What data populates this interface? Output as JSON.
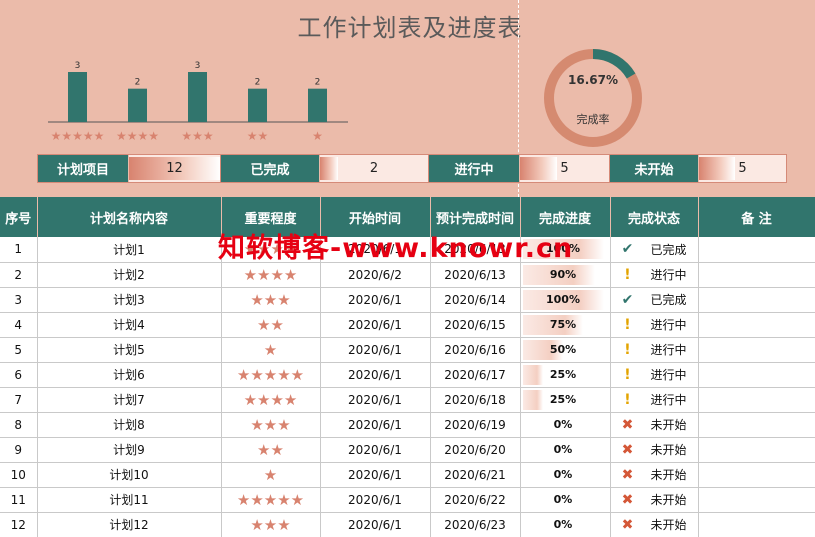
{
  "title": "工作计划表及进度表",
  "colors": {
    "accent": "#31756d",
    "background": "#ebbbaa",
    "star": "#d8836f",
    "done": "#31756d",
    "inprogress": "#e3a400",
    "todo": "#d45737"
  },
  "chart_data": [
    {
      "type": "bar",
      "categories": [
        "★★★★★",
        "★★★★",
        "★★★",
        "★★",
        "★"
      ],
      "values": [
        3,
        2,
        3,
        2,
        2
      ],
      "data_labels": [
        "3",
        "2",
        "3",
        "2",
        "2"
      ],
      "ylim": [
        0,
        3.6
      ]
    },
    {
      "type": "pie",
      "variant": "donut",
      "values": [
        16.67,
        83.33
      ],
      "center_value": "16.67%",
      "center_label": "完成率"
    }
  ],
  "summary": [
    {
      "label": "计划项目",
      "value": "12",
      "fill": 1.0
    },
    {
      "label": "已完成",
      "value": "2",
      "fill": 0.167
    },
    {
      "label": "进行中",
      "value": "5",
      "fill": 0.417
    },
    {
      "label": "未开始",
      "value": "5",
      "fill": 0.417
    }
  ],
  "table": {
    "headers": [
      "序号",
      "计划名称内容",
      "重要程度",
      "开始时间",
      "预计完成时间",
      "完成进度",
      "完成状态",
      "备 注"
    ],
    "rows": [
      {
        "no": "1",
        "name": "计划1",
        "stars": "★★★★",
        "start": "2020/6/1",
        "end": "2020/6/13",
        "progress": "100%",
        "pct": 1.0,
        "status": "已完成",
        "icon": "check-icon"
      },
      {
        "no": "2",
        "name": "计划2",
        "stars": "★★★★",
        "start": "2020/6/2",
        "end": "2020/6/13",
        "progress": "90%",
        "pct": 0.9,
        "status": "进行中",
        "icon": "exclamation-icon"
      },
      {
        "no": "3",
        "name": "计划3",
        "stars": "★★★",
        "start": "2020/6/1",
        "end": "2020/6/14",
        "progress": "100%",
        "pct": 1.0,
        "status": "已完成",
        "icon": "check-icon"
      },
      {
        "no": "4",
        "name": "计划4",
        "stars": "★★",
        "start": "2020/6/1",
        "end": "2020/6/15",
        "progress": "75%",
        "pct": 0.75,
        "status": "进行中",
        "icon": "exclamation-icon"
      },
      {
        "no": "5",
        "name": "计划5",
        "stars": "★",
        "start": "2020/6/1",
        "end": "2020/6/16",
        "progress": "50%",
        "pct": 0.5,
        "status": "进行中",
        "icon": "exclamation-icon"
      },
      {
        "no": "6",
        "name": "计划6",
        "stars": "★★★★★",
        "start": "2020/6/1",
        "end": "2020/6/17",
        "progress": "25%",
        "pct": 0.25,
        "status": "进行中",
        "icon": "exclamation-icon"
      },
      {
        "no": "7",
        "name": "计划7",
        "stars": "★★★★",
        "start": "2020/6/1",
        "end": "2020/6/18",
        "progress": "25%",
        "pct": 0.25,
        "status": "进行中",
        "icon": "exclamation-icon"
      },
      {
        "no": "8",
        "name": "计划8",
        "stars": "★★★",
        "start": "2020/6/1",
        "end": "2020/6/19",
        "progress": "0%",
        "pct": 0,
        "status": "未开始",
        "icon": "cross-icon"
      },
      {
        "no": "9",
        "name": "计划9",
        "stars": "★★",
        "start": "2020/6/1",
        "end": "2020/6/20",
        "progress": "0%",
        "pct": 0,
        "status": "未开始",
        "icon": "cross-icon"
      },
      {
        "no": "10",
        "name": "计划10",
        "stars": "★",
        "start": "2020/6/1",
        "end": "2020/6/21",
        "progress": "0%",
        "pct": 0,
        "status": "未开始",
        "icon": "cross-icon"
      },
      {
        "no": "11",
        "name": "计划11",
        "stars": "★★★★★",
        "start": "2020/6/1",
        "end": "2020/6/22",
        "progress": "0%",
        "pct": 0,
        "status": "未开始",
        "icon": "cross-icon"
      },
      {
        "no": "12",
        "name": "计划12",
        "stars": "★★★",
        "start": "2020/6/1",
        "end": "2020/6/23",
        "progress": "0%",
        "pct": 0,
        "status": "未开始",
        "icon": "cross-icon"
      }
    ]
  },
  "watermark": "知软博客-www.knowr.cn"
}
